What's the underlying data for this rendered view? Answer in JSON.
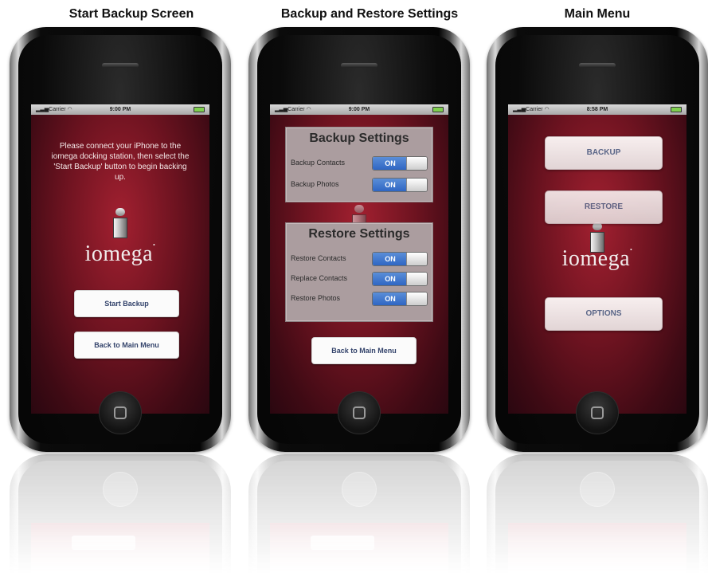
{
  "captions": {
    "left": "Start Backup Screen",
    "middle": "Backup and Restore Settings",
    "right": "Main Menu"
  },
  "status_bar": {
    "carrier": "Carrier",
    "left_time": "9:00 PM",
    "middle_time": "9:00 PM",
    "right_time": "8:58 PM"
  },
  "start_backup_screen": {
    "message": "Please connect your iPhone to the iomega docking station, then select the 'Start Backup' button to begin backing up.",
    "logo_text": "iomega",
    "start_backup_label": "Start Backup",
    "back_label": "Back to Main Menu"
  },
  "settings_screen": {
    "backup_title": "Backup Settings",
    "backup_rows": [
      {
        "label": "Backup Contacts",
        "state": "ON"
      },
      {
        "label": "Backup Photos",
        "state": "ON"
      }
    ],
    "restore_title": "Restore Settings",
    "restore_rows": [
      {
        "label": "Restore Contacts",
        "state": "ON"
      },
      {
        "label": "Replace Contacts",
        "state": "ON"
      },
      {
        "label": "Restore Photos",
        "state": "ON"
      }
    ],
    "back_label": "Back to Main Menu"
  },
  "main_menu_screen": {
    "backup_label": "BACKUP",
    "restore_label": "RESTORE",
    "logo_text": "iomega",
    "options_label": "OPTIONS"
  },
  "colors": {
    "screen_red": "#a22030",
    "toggle_blue": "#2f66c3",
    "button_text": "#33436b"
  }
}
